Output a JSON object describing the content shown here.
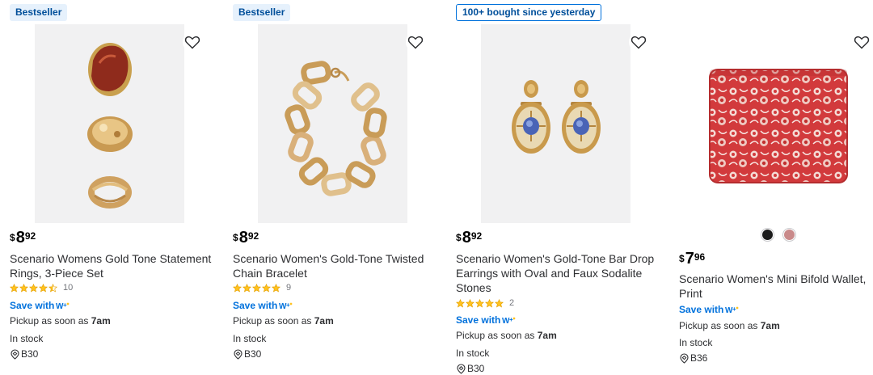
{
  "products": [
    {
      "badge": "Bestseller",
      "currency": "$",
      "dollars": "8",
      "cents": "92",
      "title": "Scenario Womens Gold Tone Statement Rings, 3-Piece Set",
      "rating": 4.5,
      "review_count": "10",
      "save_label": "Save with",
      "pickup_prefix": "Pickup as soon as",
      "pickup_time": "7am",
      "stock": "In stock",
      "location": "B30",
      "image_icon": "rings-image"
    },
    {
      "badge": "Bestseller",
      "currency": "$",
      "dollars": "8",
      "cents": "92",
      "title": "Scenario Women's Gold-Tone Twisted Chain Bracelet",
      "rating": 5,
      "review_count": "9",
      "save_label": "Save with",
      "pickup_prefix": "Pickup as soon as",
      "pickup_time": "7am",
      "stock": "In stock",
      "location": "B30",
      "image_icon": "bracelet-image"
    },
    {
      "badge": "100+ bought since yesterday",
      "currency": "$",
      "dollars": "8",
      "cents": "92",
      "title": "Scenario Women's Gold-Tone Bar Drop Earrings with Oval and Faux Sodalite Stones",
      "rating": 5,
      "review_count": "2",
      "save_label": "Save with",
      "pickup_prefix": "Pickup as soon as",
      "pickup_time": "7am",
      "stock": "In stock",
      "location": "B30",
      "image_icon": "earrings-image"
    },
    {
      "badge": "",
      "currency": "$",
      "dollars": "7",
      "cents": "96",
      "title": "Scenario Women's Mini Bifold Wallet, Print",
      "save_label": "Save with",
      "pickup_prefix": "Pickup as soon as",
      "pickup_time": "7am",
      "stock": "In stock",
      "location": "B36",
      "swatch_colors": [
        "#1b1b1b",
        "#c98a8a"
      ],
      "image_icon": "wallet-image"
    }
  ],
  "colors": {
    "accent": "#0071dc",
    "star": "#ffc220",
    "badge_bg": "#e6f1fc",
    "badge_text": "#004f9a"
  }
}
